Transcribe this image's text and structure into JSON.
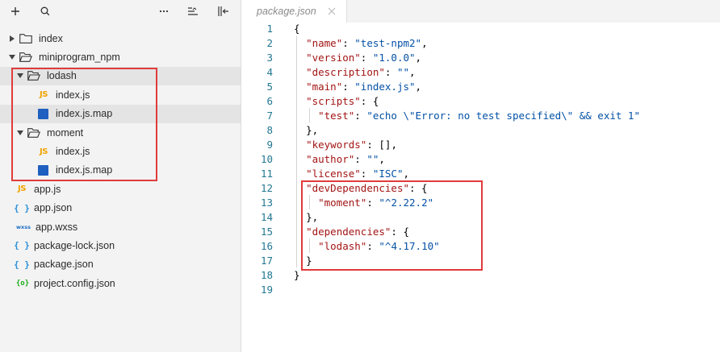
{
  "toolbar": {
    "add_icon": "plus-icon",
    "search_icon": "search-icon",
    "more_icon": "more-icon",
    "sort_icon": "sort-icon",
    "collapse_icon": "collapse-sidebar-icon"
  },
  "tree": [
    {
      "label": "index"
    },
    {
      "label": "miniprogram_npm"
    },
    {
      "label": "lodash"
    },
    {
      "label": "index.js"
    },
    {
      "label": "index.js.map"
    },
    {
      "label": "moment"
    },
    {
      "label": "index.js"
    },
    {
      "label": "index.js.map"
    },
    {
      "label": "app.js"
    },
    {
      "label": "app.json"
    },
    {
      "label": "app.wxss"
    },
    {
      "label": "package-lock.json"
    },
    {
      "label": "package.json"
    },
    {
      "label": "project.config.json"
    }
  ],
  "icons": {
    "js": "JS",
    "json": "{ }",
    "wxss": "wxss",
    "config": "{o}"
  },
  "editor": {
    "tab_label": "package.json",
    "lines": [
      {
        "n": "1"
      },
      {
        "n": "2"
      },
      {
        "n": "3"
      },
      {
        "n": "4"
      },
      {
        "n": "5"
      },
      {
        "n": "6"
      },
      {
        "n": "7"
      },
      {
        "n": "8"
      },
      {
        "n": "9"
      },
      {
        "n": "10"
      },
      {
        "n": "11"
      },
      {
        "n": "12"
      },
      {
        "n": "13"
      },
      {
        "n": "14"
      },
      {
        "n": "15"
      },
      {
        "n": "16"
      },
      {
        "n": "17"
      },
      {
        "n": "18"
      },
      {
        "n": "19"
      }
    ],
    "code": {
      "l1": "{",
      "l2k": "\"name\"",
      "l2v": "\"test-npm2\"",
      "l3k": "\"version\"",
      "l3v": "\"1.0.0\"",
      "l4k": "\"description\"",
      "l4v": "\"\"",
      "l5k": "\"main\"",
      "l5v": "\"index.js\"",
      "l6k": "\"scripts\"",
      "l7k": "\"test\"",
      "l7v": "\"echo \\\"Error: no test specified\\\" && exit 1\"",
      "l8": "},",
      "l9k": "\"keywords\"",
      "l9v": "[]",
      "l10k": "\"author\"",
      "l10v": "\"\"",
      "l11k": "\"license\"",
      "l11v": "\"ISC\"",
      "l12k": "\"devDependencies\"",
      "l13k": "\"moment\"",
      "l13v": "\"^2.22.2\"",
      "l14": "},",
      "l15k": "\"dependencies\"",
      "l16k": "\"lodash\"",
      "l16v": "\"^4.17.10\"",
      "l17": "}",
      "l18": "}"
    }
  },
  "colors": {
    "highlight": "#e03b3b",
    "json_key": "#a31515",
    "json_string": "#0451a5",
    "line_number": "#237893"
  }
}
